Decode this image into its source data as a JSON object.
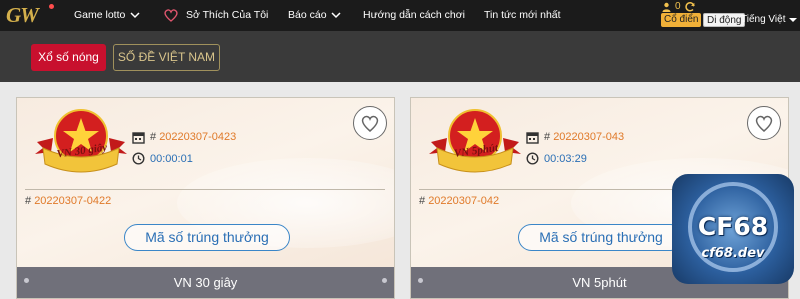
{
  "nav": {
    "logo": "GW",
    "items": [
      "Game lotto",
      "Sở Thích Của Tôi",
      "Báo cáo",
      "Hướng dẫn cách chơi",
      "Tin tức mới nhất"
    ],
    "balance": "0",
    "mode_classic": "Cổ điển",
    "mode_mobile": "Di động",
    "language": "Tiếng Việt"
  },
  "subnav": {
    "hot_button": "Xổ số nóng",
    "vn_button": "SỐ ĐỀ VIỆT NAM"
  },
  "cards": [
    {
      "badge": "VN 30 giây",
      "hash": "#",
      "current_issue": "20220307-0423",
      "timer": "00:00:01",
      "prev_issue": "20220307-0422",
      "result_button": "Mã số trúng thưởng",
      "footer": "VN 30 giây"
    },
    {
      "badge": "VN 5phút",
      "hash": "#",
      "current_issue": "20220307-043",
      "timer": "00:03:29",
      "prev_issue": "20220307-042",
      "result_button": "Mã số trúng thưởng",
      "footer": "VN 5phút"
    }
  ],
  "watermark": {
    "brand": "CF68",
    "domain": "cf68.dev"
  },
  "colors": {
    "topbar": "#1b1b1b",
    "subbar": "#3a3a3a",
    "hot_red": "#c8102e",
    "issue_orange": "#e07a2a",
    "timer_blue": "#2a6fb5",
    "footer_gray": "#70707a"
  }
}
